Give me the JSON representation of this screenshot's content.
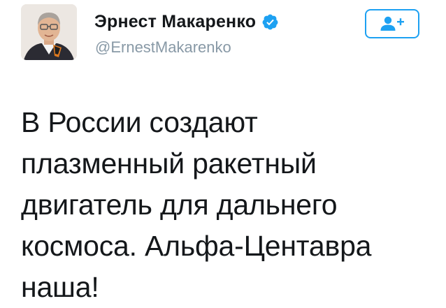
{
  "tweet": {
    "author": {
      "display_name": "Эрнест Макаренко",
      "username": "@ErnestMakarenko",
      "verified": true,
      "avatar_icon": "user-avatar-photo"
    },
    "follow_button": {
      "icon": "add-user-icon",
      "accent_color": "#1da1f2"
    },
    "text_lines": [
      "В России создают",
      "плазменный ракетный",
      "двигатель для дальнего",
      "космоса. Альфа-Центавра",
      "наша!"
    ]
  },
  "colors": {
    "text": "#14171a",
    "secondary_text": "#8899a6",
    "verified_badge": "#1da1f2"
  }
}
